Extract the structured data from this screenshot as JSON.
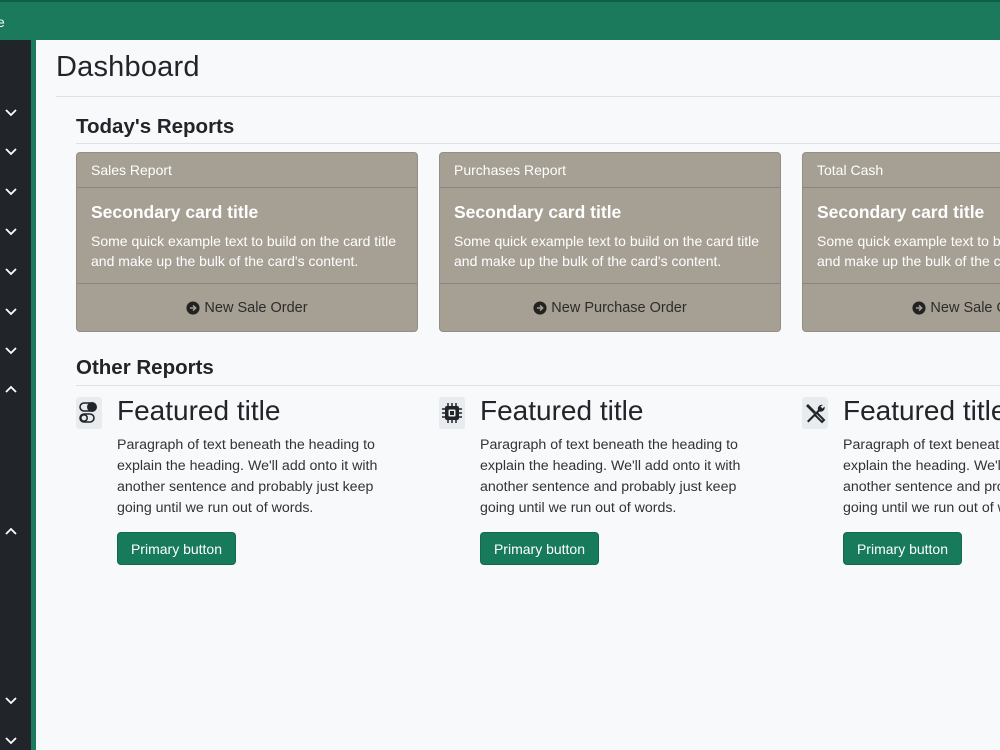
{
  "topbar": {
    "brand_fragment": "e",
    "color": "#1a7a5b"
  },
  "sidebar": {
    "toggles": [
      {
        "icon": "chevron-down-icon"
      },
      {
        "icon": "chevron-down-icon"
      },
      {
        "icon": "chevron-down-icon"
      },
      {
        "icon": "chevron-down-icon"
      },
      {
        "icon": "chevron-down-icon"
      },
      {
        "icon": "chevron-down-icon"
      },
      {
        "icon": "chevron-down-icon"
      },
      {
        "icon": "chevron-up-icon"
      },
      {
        "icon": "chevron-up-icon"
      },
      {
        "icon": "chevron-down-icon"
      },
      {
        "icon": "chevron-down-icon"
      }
    ]
  },
  "page": {
    "title": "Dashboard"
  },
  "todays_reports": {
    "heading": "Today's Reports",
    "cards": [
      {
        "header": "Sales Report",
        "title": "Secondary card title",
        "text": "Some quick example text to build on the card title and make up the bulk of the card's content.",
        "footer": "New Sale Order",
        "footer_icon": "arrow-right-circle-icon"
      },
      {
        "header": "Purchases Report",
        "title": "Secondary card title",
        "text": "Some quick example text to build on the card title and make up the bulk of the card's content.",
        "footer": "New Purchase Order",
        "footer_icon": "arrow-right-circle-icon"
      },
      {
        "header": "Total Cash",
        "title": "Secondary card title",
        "text": "Some quick example text to build on the card title and make up the bulk of the card's content.",
        "footer": "New Sale Order",
        "footer_icon": "arrow-right-circle-icon"
      }
    ]
  },
  "other_reports": {
    "heading": "Other Reports",
    "features": [
      {
        "icon": "toggles-icon",
        "title": "Featured title",
        "text": "Paragraph of text beneath the heading to explain the heading. We'll add onto it with another sentence and probably just keep going until we run out of words.",
        "button": "Primary button"
      },
      {
        "icon": "cpu-icon",
        "title": "Featured title",
        "text": "Paragraph of text beneath the heading to explain the heading. We'll add onto it with another sentence and probably just keep going until we run out of words.",
        "button": "Primary button"
      },
      {
        "icon": "tools-icon",
        "title": "Featured title",
        "text": "Paragraph of text beneath the heading to explain the heading. We'll add onto it with another sentence and probably just keep going until we run out of words.",
        "button": "Primary button"
      }
    ]
  },
  "colors": {
    "accent": "#1a7a5b",
    "card_bg": "#a69f94",
    "sidebar_bg": "#212529",
    "button_bg": "#177a5a"
  }
}
